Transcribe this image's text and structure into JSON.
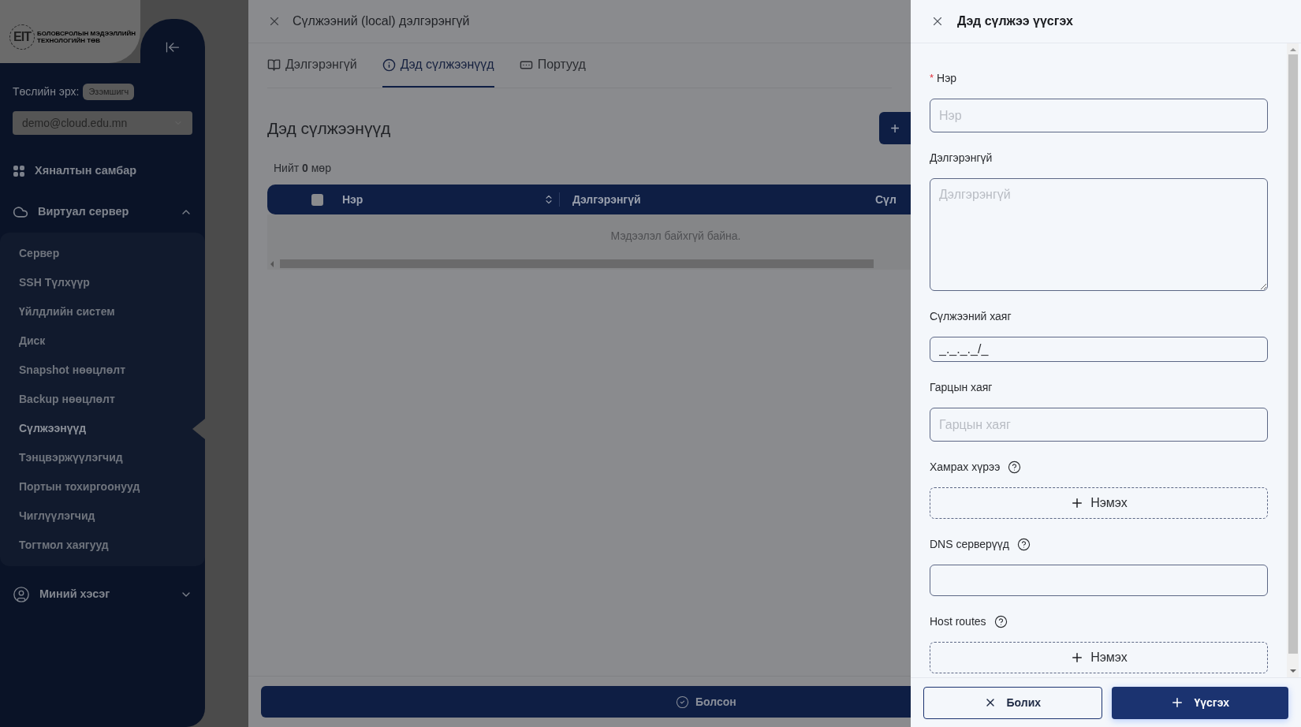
{
  "sidebar": {
    "logo_mark": "EIT",
    "logo_lines": [
      "БОЛОВСРОЛЫН МЭДЭЭЛЛИЙН",
      "ТЕХНОЛОГИЙН ТӨВ"
    ],
    "role_label": "Төслийн эрх:",
    "role_badge": "Эзэмшигч",
    "project_select": {
      "value": "demo@cloud.edu.mn"
    },
    "nav": [
      {
        "label": "Хяналтын самбар",
        "kind": "grid"
      },
      {
        "label": "Виртуал сервер",
        "kind": "cloud",
        "expanded": true,
        "children": [
          {
            "label": "Сервер",
            "selected": false
          },
          {
            "label": "SSH Түлхүүр",
            "selected": false
          },
          {
            "label": "Үйлдлийн систем",
            "selected": false
          },
          {
            "label": "Диск",
            "selected": false
          },
          {
            "label": "Snapshot нөөцлөлт",
            "selected": false
          },
          {
            "label": "Backup нөөцлөлт",
            "selected": false
          },
          {
            "label": "Сүлжээнүүд",
            "selected": true
          },
          {
            "label": "Тэнцвэржүүлэгчид",
            "selected": false
          },
          {
            "label": "Портын тохиргоонууд",
            "selected": false
          },
          {
            "label": "Чиглүүлэгчид",
            "selected": false
          },
          {
            "label": "Тогтмол хаягууд",
            "selected": false
          }
        ]
      },
      {
        "label": "Миний хэсэг",
        "kind": "user",
        "expanded": false
      }
    ]
  },
  "details_drawer": {
    "title": "Сүлжээний (local) дэлгэрэнгүй",
    "tabs": [
      {
        "label": "Дэлгэрэнгүй",
        "kind": "book",
        "selected": false
      },
      {
        "label": "Дэд сүлжээнүүд",
        "kind": "info",
        "selected": true
      },
      {
        "label": "Портууд",
        "kind": "port",
        "selected": false
      }
    ],
    "section_title": "Дэд сүлжээнүүд",
    "add_button": "+",
    "row_count": "Нийт **0** мөр",
    "table": {
      "select_all_checked": false,
      "columns": [
        {
          "label": "Нэр",
          "sortable": true
        },
        {
          "label": "Дэлгэрэнгүй",
          "sortable": false
        },
        {
          "label": "Сүл",
          "sortable": false
        }
      ],
      "empty_text": "Мэдээлэл байхгүй байна."
    },
    "done_button": "Болсон"
  },
  "create_drawer": {
    "title": "Дэд сүлжээ үүсгэх",
    "fields": [
      {
        "kind": "text",
        "required_mark": "*",
        "label": "Нэр",
        "help": false,
        "placeholder": "Нэр"
      },
      {
        "kind": "textarea",
        "label": "Дэлгэрэнгүй",
        "help": false,
        "placeholder": "Дэлгэрэнгүй"
      },
      {
        "kind": "masked",
        "label": "Сүлжээний хаяг",
        "help": false,
        "value": "_._._._/_"
      },
      {
        "kind": "text",
        "label": "Гарцын хаяг",
        "help": false,
        "placeholder": "Гарцын хаяг"
      },
      {
        "kind": "add",
        "label": "Хамрах хүрээ",
        "help": true,
        "button": "Нэмэх"
      },
      {
        "kind": "tags",
        "label": "DNS серверүүд",
        "help": true
      },
      {
        "kind": "add",
        "label": "Host routes",
        "help": true,
        "button": "Нэмэх"
      }
    ],
    "cancel_button": "Болих",
    "submit_button": "Үүсгэх"
  }
}
